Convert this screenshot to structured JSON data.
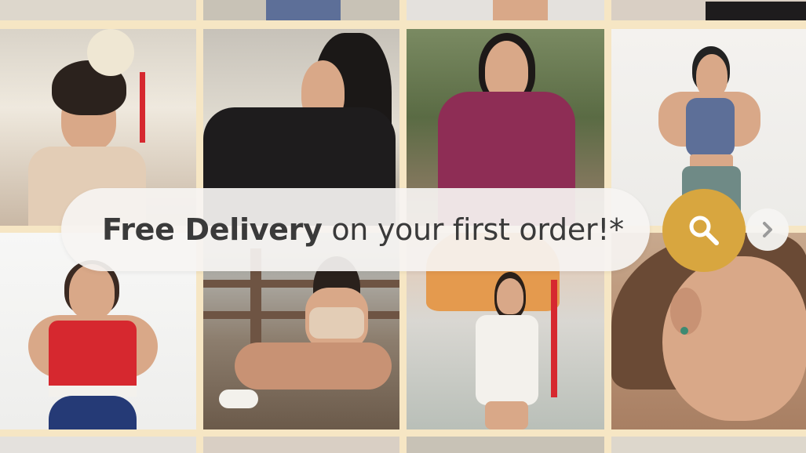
{
  "banner": {
    "text_strong": "Free Delivery",
    "text_rest": " on your first order!*"
  },
  "icons": {
    "search": "search-icon",
    "next": "chevron-right-icon"
  },
  "colors": {
    "background": "#f6e6c4",
    "search_button": "#d8a63f",
    "banner_bg": "#f6f4f2",
    "text": "#3a3a3a"
  },
  "photos": [
    {
      "name": "photo-woman-flowers-beige-top"
    },
    {
      "name": "photo-woman-black-top"
    },
    {
      "name": "photo-woman-magenta-tshirt"
    },
    {
      "name": "photo-woman-blue-sports-bra"
    },
    {
      "name": "photo-woman-red-swimsuit"
    },
    {
      "name": "photo-woman-beige-set-sitting"
    },
    {
      "name": "photo-woman-umbrella-white-set"
    },
    {
      "name": "photo-woman-earring-closeup"
    }
  ]
}
